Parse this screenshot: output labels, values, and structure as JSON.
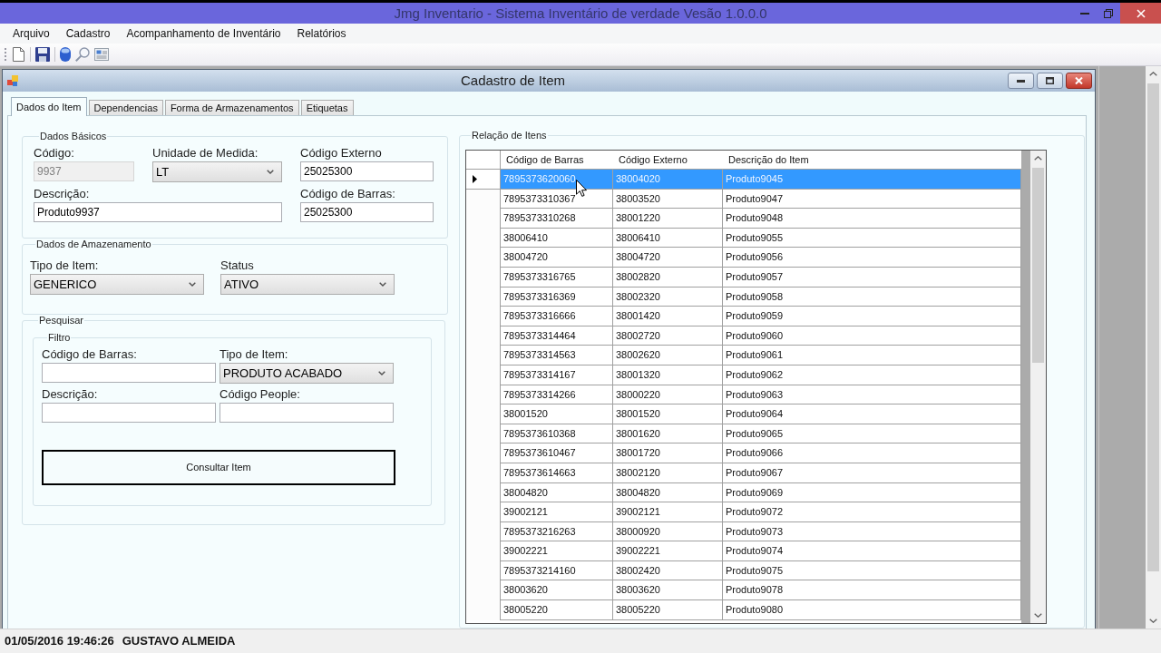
{
  "window": {
    "title": "Jmg Inventario - Sistema Inventário de verdade Vesão 1.0.0.0"
  },
  "menu": [
    {
      "label": "Arquivo"
    },
    {
      "label": "Cadastro"
    },
    {
      "label": "Acompanhamento de Inventário"
    },
    {
      "label": "Relatórios"
    }
  ],
  "child_window": {
    "title": "Cadastro de Item"
  },
  "tabs": [
    {
      "label": "Dados do Item",
      "selected": true
    },
    {
      "label": "Dependencias",
      "selected": false
    },
    {
      "label": "Forma de Armazenamentos",
      "selected": false
    },
    {
      "label": "Etiquetas",
      "selected": false
    }
  ],
  "basic_data": {
    "title": "Dados Básicos",
    "fields": [
      {
        "kind": "text",
        "label": "Código:",
        "value": "9937",
        "disabled": true
      },
      {
        "kind": "select",
        "label": "Unidade de Medida:",
        "value": "LT",
        "disabled": false
      },
      {
        "kind": "text",
        "label": "Código Externo",
        "value": "25025300",
        "disabled": false
      },
      {
        "kind": "text",
        "label": "Descrição:",
        "value": "Produto9937",
        "disabled": false
      },
      {
        "kind": "text",
        "label": "Código de Barras:",
        "value": "25025300",
        "disabled": false
      }
    ]
  },
  "storage_data": {
    "title": "Dados de Amazenamento",
    "fields": [
      {
        "kind": "select",
        "label": "Tipo de Item:",
        "value": "GENERICO"
      },
      {
        "kind": "select",
        "label": "Status",
        "value": "ATIVO"
      }
    ]
  },
  "search": {
    "title": "Pesquisar",
    "filter": {
      "title": "Filtro",
      "fields": [
        {
          "kind": "text",
          "label": "Código de Barras:"
        },
        {
          "kind": "select",
          "label": "Tipo de Item:",
          "value": "PRODUTO ACABADO"
        },
        {
          "kind": "text",
          "label": "Descrição:"
        },
        {
          "kind": "text",
          "label": "Código People:"
        }
      ],
      "button": "Consultar Item"
    }
  },
  "items": {
    "title": "Relação de Itens",
    "columns": [
      "Código de Barras",
      "Código Externo",
      "Descrição do Item"
    ],
    "rows": [
      {
        "cells": [
          "7895373620060",
          "38004020",
          "Produto9045"
        ],
        "selected": true
      },
      {
        "cells": [
          "7895373310367",
          "38003520",
          "Produto9047"
        ],
        "selected": false
      },
      {
        "cells": [
          "7895373310268",
          "38001220",
          "Produto9048"
        ],
        "selected": false
      },
      {
        "cells": [
          "38006410",
          "38006410",
          "Produto9055"
        ],
        "selected": false
      },
      {
        "cells": [
          "38004720",
          "38004720",
          "Produto9056"
        ],
        "selected": false
      },
      {
        "cells": [
          "7895373316765",
          "38002820",
          "Produto9057"
        ],
        "selected": false
      },
      {
        "cells": [
          "7895373316369",
          "38002320",
          "Produto9058"
        ],
        "selected": false
      },
      {
        "cells": [
          "7895373316666",
          "38001420",
          "Produto9059"
        ],
        "selected": false
      },
      {
        "cells": [
          "7895373314464",
          "38002720",
          "Produto9060"
        ],
        "selected": false
      },
      {
        "cells": [
          "7895373314563",
          "38002620",
          "Produto9061"
        ],
        "selected": false
      },
      {
        "cells": [
          "7895373314167",
          "38001320",
          "Produto9062"
        ],
        "selected": false
      },
      {
        "cells": [
          "7895373314266",
          "38000220",
          "Produto9063"
        ],
        "selected": false
      },
      {
        "cells": [
          "38001520",
          "38001520",
          "Produto9064"
        ],
        "selected": false
      },
      {
        "cells": [
          "7895373610368",
          "38001620",
          "Produto9065"
        ],
        "selected": false
      },
      {
        "cells": [
          "7895373610467",
          "38001720",
          "Produto9066"
        ],
        "selected": false
      },
      {
        "cells": [
          "7895373614663",
          "38002120",
          "Produto9067"
        ],
        "selected": false
      },
      {
        "cells": [
          "38004820",
          "38004820",
          "Produto9069"
        ],
        "selected": false
      },
      {
        "cells": [
          "39002121",
          "39002121",
          "Produto9072"
        ],
        "selected": false
      },
      {
        "cells": [
          "7895373216263",
          "38000920",
          "Produto9073"
        ],
        "selected": false
      },
      {
        "cells": [
          "39002221",
          "39002221",
          "Produto9074"
        ],
        "selected": false
      },
      {
        "cells": [
          "7895373214160",
          "38002420",
          "Produto9075"
        ],
        "selected": false
      },
      {
        "cells": [
          "38003620",
          "38003620",
          "Produto9078"
        ],
        "selected": false
      },
      {
        "cells": [
          "38005220",
          "38005220",
          "Produto9080"
        ],
        "selected": false
      }
    ]
  },
  "status_bar": {
    "datetime": "01/05/2016 19:46:26",
    "user": "GUSTAVO ALMEIDA"
  }
}
